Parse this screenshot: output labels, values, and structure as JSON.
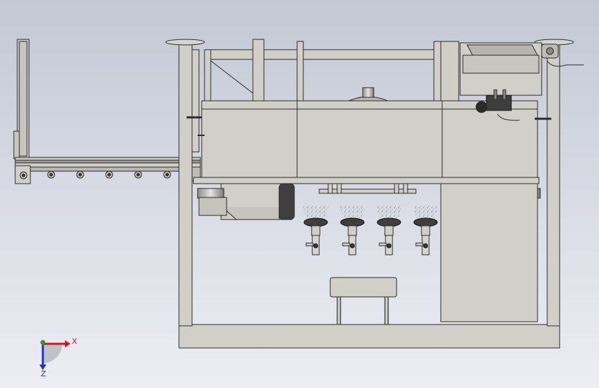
{
  "viewport": {
    "background_top": "#c3c8d4",
    "background_bottom": "#eceef3"
  },
  "colors": {
    "frame_fill": "#d0cfc8",
    "frame_stroke": "#2a2a2a",
    "panel_fill": "#c9c8c0",
    "dark_part": "#3a3a3a",
    "axis_x": "#d01818",
    "axis_y": "#2a9a2a",
    "axis_z": "#2030d0"
  },
  "model": {
    "nozzle_count": 4,
    "roller_count": 7,
    "icons": [
      "conveyor-roller-icon",
      "spray-nozzle-icon",
      "valve-icon",
      "motor-icon"
    ]
  },
  "triad": {
    "x_label": "X",
    "z_label": "Z"
  }
}
